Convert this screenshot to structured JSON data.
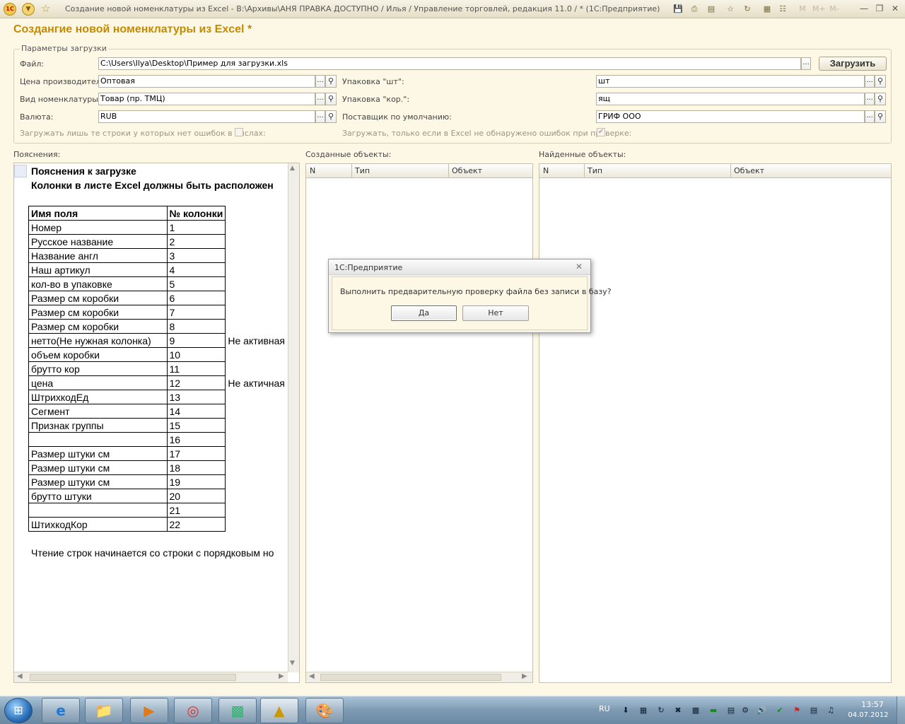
{
  "window": {
    "title": "Создание новой номенклатуры из Excel - В:\\Архивы\\АНЯ ПРАВКА ДОСТУПНО / Илья /  Управление торговлей, редакция 11.0 / * (1С:Предприятие)",
    "logo": "1С",
    "minimize": "—",
    "restore": "❐",
    "close": "✕",
    "toolbar_icons": [
      "save-icon",
      "print-icon",
      "preview-icon",
      "favorite-add-icon",
      "history-icon",
      "calculator-icon",
      "calendar-icon",
      "memory-m-icon",
      "memory-mplus-icon",
      "memory-mminus-icon"
    ],
    "mem_m": "M",
    "mem_mplus": "M+",
    "mem_mminus": "M-"
  },
  "form": {
    "heading": "Создангие новой номенклатуры из Excel *",
    "params_legend": "Параметры загрузки",
    "file_label": "Файл:",
    "file_value": "C:\\Users\\Ilya\\Desktop\\Пример для загрузки.xls",
    "load_button": "Загрузить",
    "price_label": "Цена производителя:",
    "price_value": "Оптовая",
    "kind_label": "Вид номенклатуры:",
    "kind_value": "Товар (пр. ТМЦ)",
    "currency_label": "Валюта:",
    "currency_value": "RUB",
    "pack_pcs_label": "Упаковка \"шт\":",
    "pack_pcs_value": "шт",
    "pack_box_label": "Упаковка \"кор.\":",
    "pack_box_value": "ящ",
    "supplier_label": "Поставщик по умолчанию:",
    "supplier_value": "ГРИФ ООО",
    "load_no_errors_label": "Загружать лишь те строки у которых нет ошибок в числах:",
    "load_no_errors_checked": false,
    "load_if_check_label": "Загружать, только если в Excel не обнаружено ошибок при проверке:",
    "load_if_check_checked": true,
    "ellipsis": "...",
    "checkmark": "✔"
  },
  "explanations": {
    "label": "Пояснения:",
    "title": "Пояснения к загрузке",
    "subtitle": "Колонки в листе Excel должны быть расположен",
    "table_header": [
      "Имя поля",
      "№ колонки"
    ],
    "rows": [
      {
        "name": "Номер",
        "col": "1",
        "note": ""
      },
      {
        "name": "Русское название",
        "col": "2",
        "note": ""
      },
      {
        "name": "Название англ",
        "col": "3",
        "note": ""
      },
      {
        "name": "Наш артикул",
        "col": "4",
        "note": ""
      },
      {
        "name": "кол-во в упаковке",
        "col": "5",
        "note": ""
      },
      {
        "name": "Размер см коробки",
        "col": "6",
        "note": ""
      },
      {
        "name": "Размер см коробки",
        "col": "7",
        "note": ""
      },
      {
        "name": "Размер см коробки",
        "col": "8",
        "note": ""
      },
      {
        "name": "нетто(Не нужная колонка)",
        "col": "9",
        "note": "Не активная"
      },
      {
        "name": "объем коробки",
        "col": "10",
        "note": ""
      },
      {
        "name": "брутто кор",
        "col": "11",
        "note": ""
      },
      {
        "name": "цена",
        "col": "12",
        "note": "Не актичная"
      },
      {
        "name": "ШтрихкодЕд",
        "col": "13",
        "note": ""
      },
      {
        "name": "Сегмент",
        "col": "14",
        "note": ""
      },
      {
        "name": "Признак группы",
        "col": "15",
        "note": ""
      },
      {
        "name": "",
        "col": "16",
        "note": ""
      },
      {
        "name": "Размер штуки см",
        "col": "17",
        "note": ""
      },
      {
        "name": "Размер штуки см",
        "col": "18",
        "note": ""
      },
      {
        "name": "Размер штуки см",
        "col": "19",
        "note": ""
      },
      {
        "name": "брутто штуки",
        "col": "20",
        "note": ""
      },
      {
        "name": "",
        "col": "21",
        "note": ""
      },
      {
        "name": "ШтихкодКор",
        "col": "22",
        "note": ""
      }
    ],
    "footer": "Чтение строк начинается со строки с порядковым но"
  },
  "created": {
    "label": "Созданные объекты:",
    "columns": [
      "N",
      "Тип",
      "Объект"
    ]
  },
  "found": {
    "label": "Найденные объекты:",
    "columns": [
      "N",
      "Тип",
      "Объект"
    ]
  },
  "dialog": {
    "title": "1С:Предприятие",
    "message": "Выполнить предварительную проверку файла без записи в базу?",
    "yes": "Да",
    "no": "Нет",
    "close": "✕"
  },
  "taskbar": {
    "lang": "RU",
    "time": "13:57",
    "date": "04.07.2012",
    "apps": [
      "internet-explorer-icon",
      "file-explorer-icon",
      "media-player-icon",
      "chrome-icon",
      "terminal-icon",
      "drawing-app-icon",
      "paint-app-icon"
    ]
  },
  "colors": {
    "accent": "#c48a00",
    "form_bg": "#fdf8e6"
  }
}
